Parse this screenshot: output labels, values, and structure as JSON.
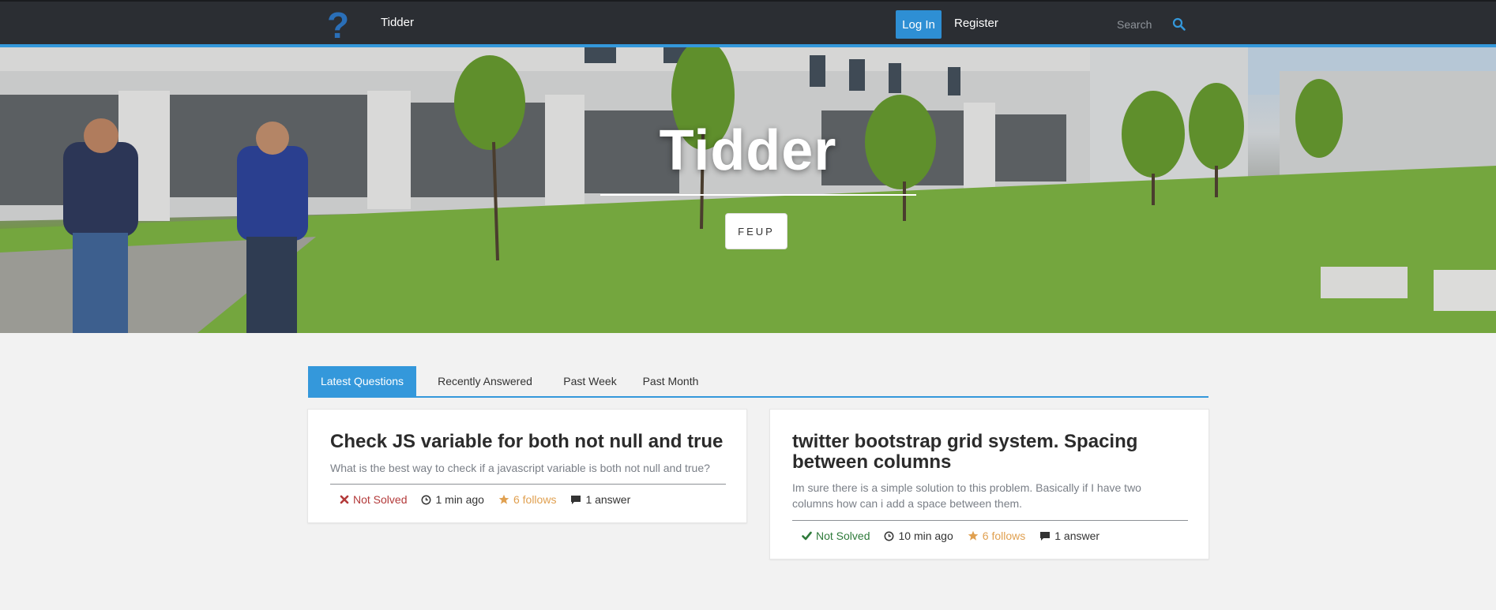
{
  "navbar": {
    "brand": "Tidder",
    "login_label": "Log In",
    "register_label": "Register",
    "search_placeholder": "Search",
    "logo_icon": "question-mark-icon",
    "search_icon": "search-icon",
    "accent_color": "#3498db"
  },
  "hero": {
    "title": "Tidder",
    "button_label": "FEUP"
  },
  "tabs": [
    {
      "label": "Latest Questions",
      "active": true
    },
    {
      "label": "Recently Answered",
      "active": false
    },
    {
      "label": "Past Week",
      "active": false
    },
    {
      "label": "Past Month",
      "active": false
    }
  ],
  "questions": [
    {
      "title": "Check JS variable for both not null and true",
      "excerpt": "What is the best way to check if a javascript variable is both not null and true?",
      "status": "Not Solved",
      "status_icon": "x-icon",
      "status_color": "#b33a3a",
      "time": "1 min ago",
      "follows": "6 follows",
      "answers": "1 answer"
    },
    {
      "title": "twitter bootstrap grid system. Spacing between columns",
      "excerpt": "Im sure there is a simple solution to this problem. Basically if I have two columns how can i add a space between them.",
      "status": "Not Solved",
      "status_icon": "checkmark-icon",
      "status_color": "#2e7a3a",
      "time": "10 min ago",
      "follows": "6 follows",
      "answers": "1 answer"
    }
  ]
}
